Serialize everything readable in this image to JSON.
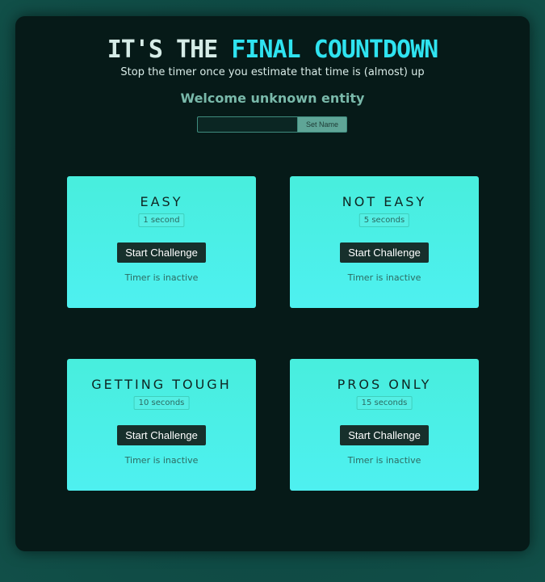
{
  "header": {
    "title_part1": "IT'S THE ",
    "title_part2": "FINAL COUNTDOWN",
    "subtitle": "Stop the timer once you estimate that time is (almost) up",
    "welcome": "Welcome unknown entity"
  },
  "name_form": {
    "input_value": "",
    "button_label": "Set Name"
  },
  "challenges": [
    {
      "title": "EASY",
      "duration": "1 second",
      "button_label": "Start Challenge",
      "status": "Timer is inactive"
    },
    {
      "title": "NOT EASY",
      "duration": "5 seconds",
      "button_label": "Start Challenge",
      "status": "Timer is inactive"
    },
    {
      "title": "GETTING TOUGH",
      "duration": "10 seconds",
      "button_label": "Start Challenge",
      "status": "Timer is inactive"
    },
    {
      "title": "PROS ONLY",
      "duration": "15 seconds",
      "button_label": "Start Challenge",
      "status": "Timer is inactive"
    }
  ],
  "colors": {
    "page_background": "#0f4a44",
    "panel_background": "#061a18",
    "accent_cyan": "#2fe3f0",
    "card_gradient_top": "#48eedd",
    "card_gradient_bottom": "#4ef0f0",
    "button_dark": "#17302c"
  }
}
